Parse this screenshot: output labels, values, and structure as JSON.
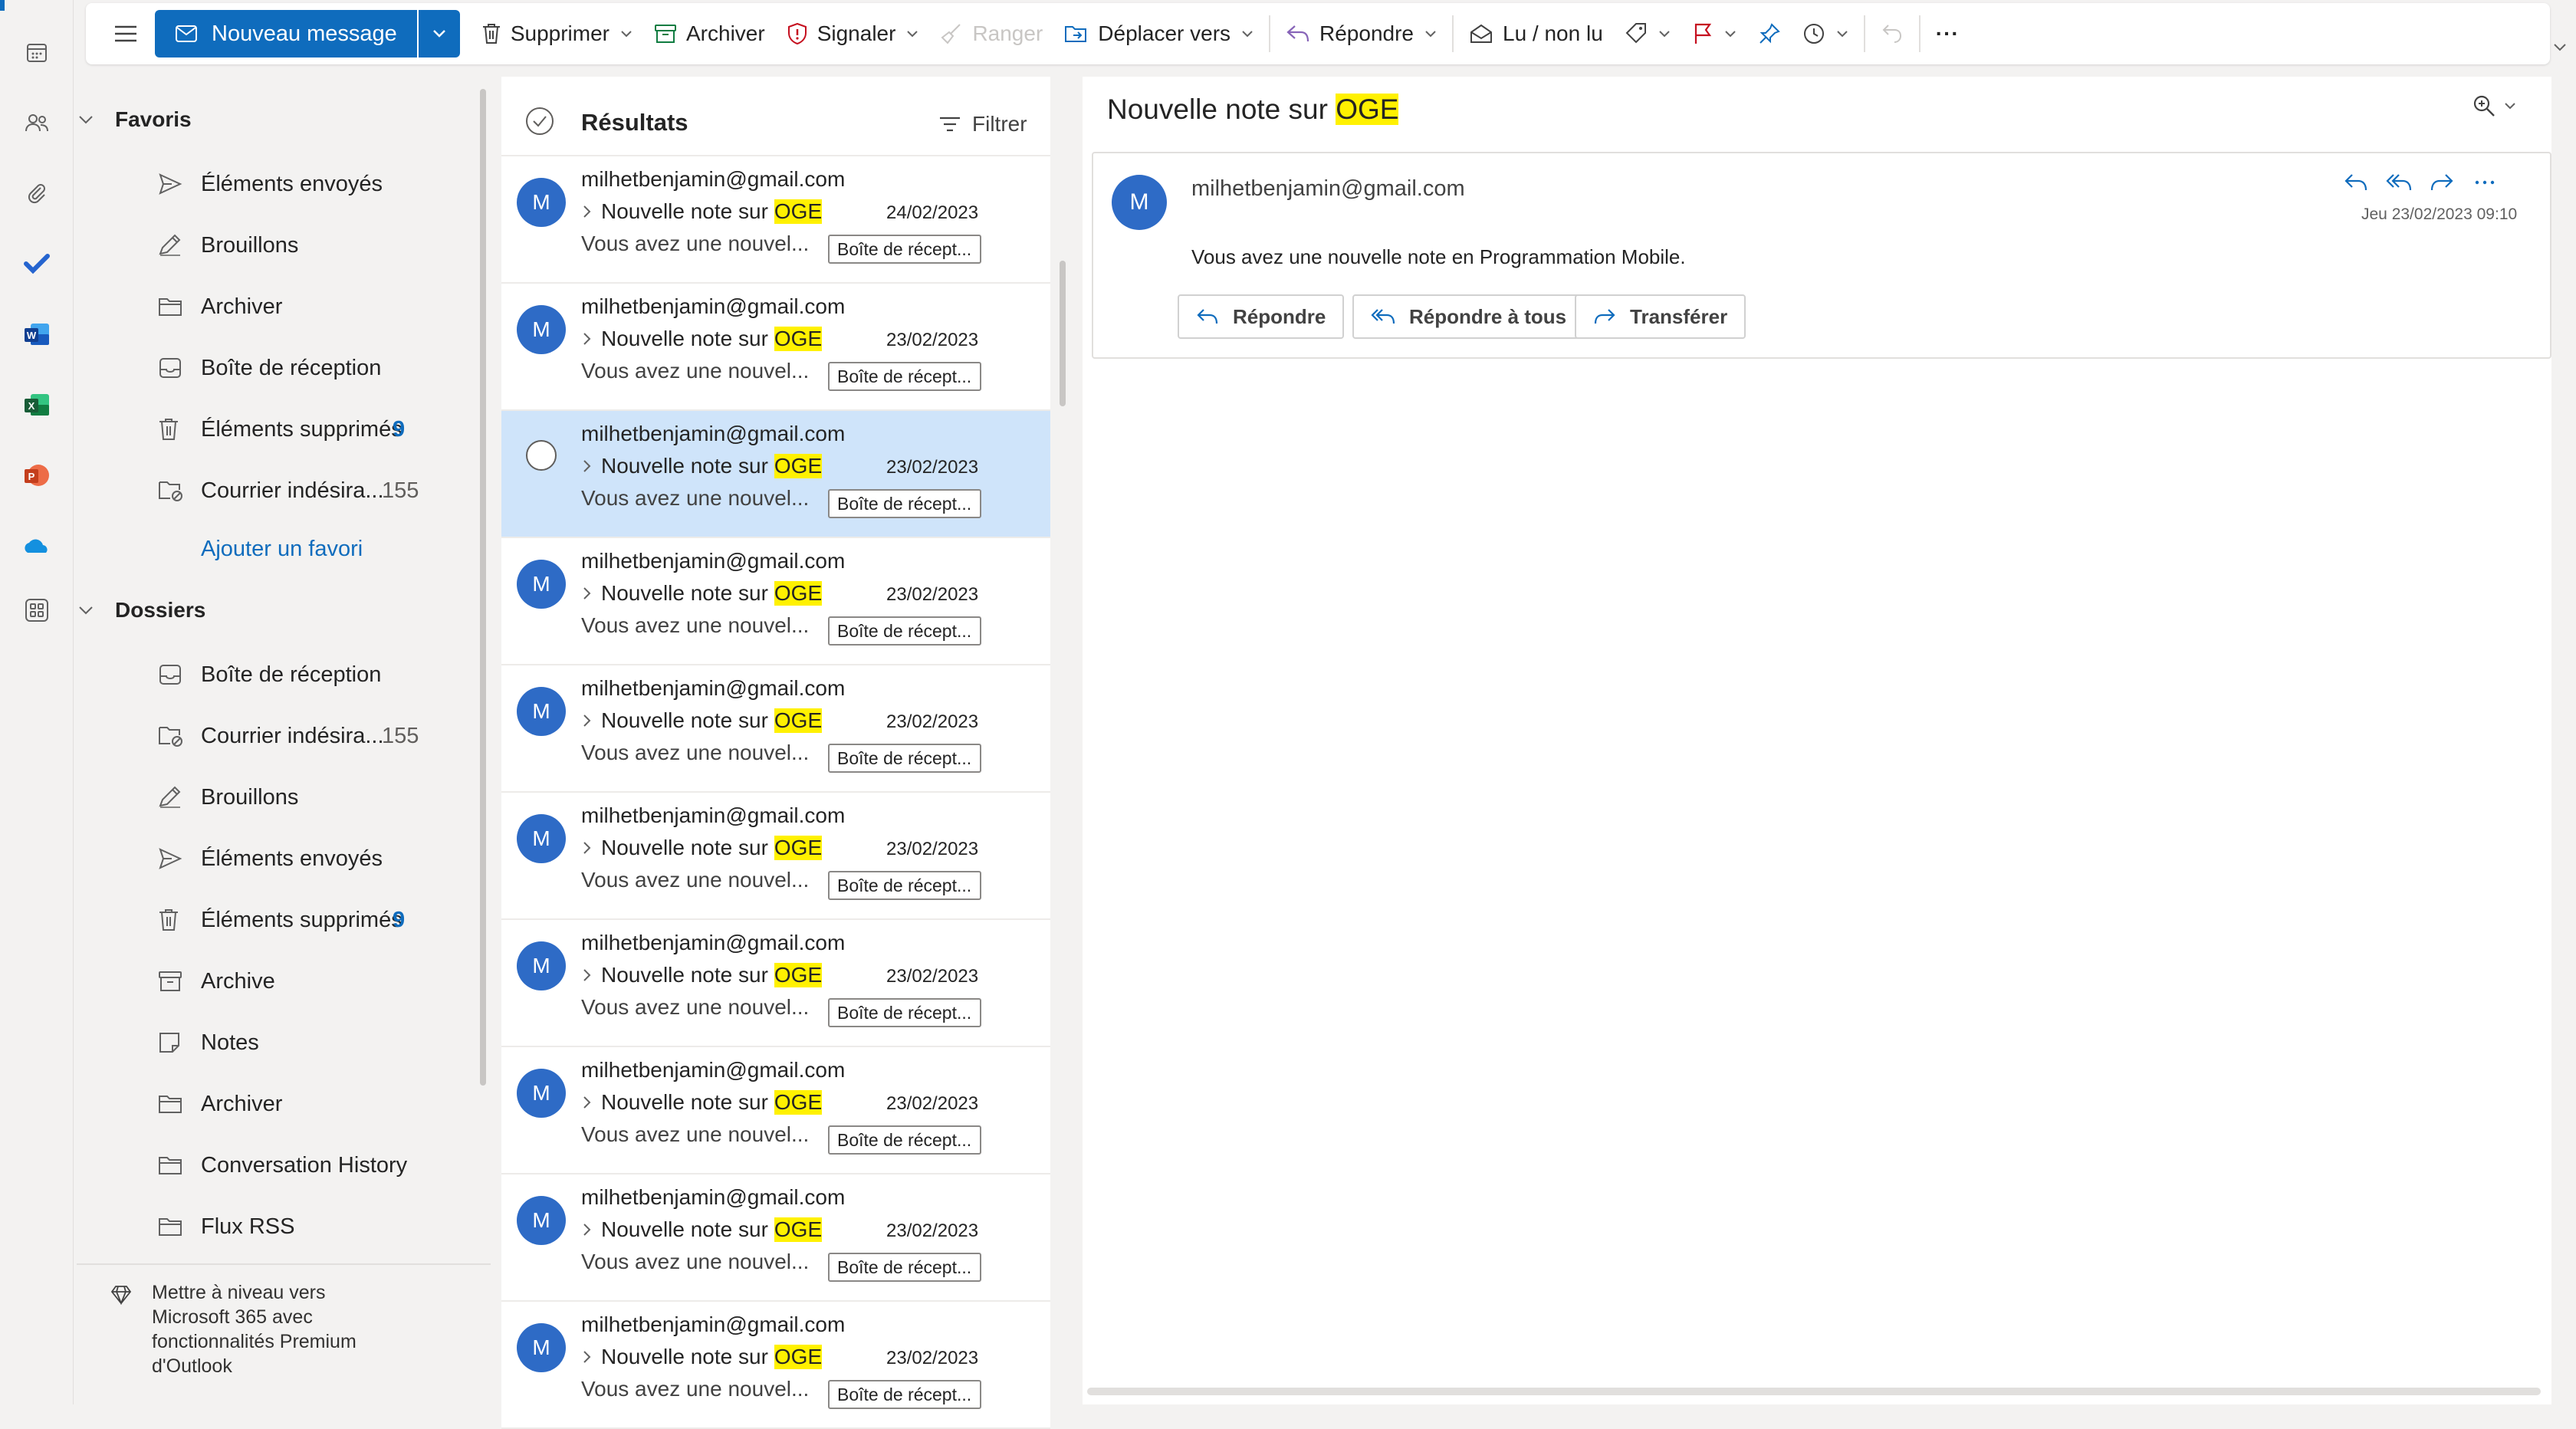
{
  "toolbar": {
    "new_message": "Nouveau message",
    "delete": "Supprimer",
    "archive": "Archiver",
    "report": "Signaler",
    "sweep": "Ranger",
    "move_to": "Déplacer vers",
    "reply": "Répondre",
    "read_unread": "Lu / non lu",
    "more": "···"
  },
  "folders": {
    "favorites_header": "Favoris",
    "favorites": [
      {
        "label": "Éléments envoyés",
        "icon": "send-icon",
        "count": ""
      },
      {
        "label": "Brouillons",
        "icon": "draft-icon",
        "count": ""
      },
      {
        "label": "Archiver",
        "icon": "folder-icon",
        "count": ""
      },
      {
        "label": "Boîte de réception",
        "icon": "inbox-icon",
        "count": ""
      },
      {
        "label": "Éléments supprimés",
        "icon": "trash-icon",
        "count": "9"
      },
      {
        "label": "Courrier indésira...",
        "icon": "junk-icon",
        "count": "155"
      }
    ],
    "add_favorite": "Ajouter un favori",
    "folders_header": "Dossiers",
    "items": [
      {
        "label": "Boîte de réception",
        "icon": "inbox-icon",
        "count": ""
      },
      {
        "label": "Courrier indésira...",
        "icon": "junk-icon",
        "count": "155"
      },
      {
        "label": "Brouillons",
        "icon": "draft-icon",
        "count": ""
      },
      {
        "label": "Éléments envoyés",
        "icon": "send-icon",
        "count": ""
      },
      {
        "label": "Éléments supprimés",
        "icon": "trash-icon",
        "count": "9"
      },
      {
        "label": "Archive",
        "icon": "archive-icon",
        "count": ""
      },
      {
        "label": "Notes",
        "icon": "note-icon",
        "count": ""
      },
      {
        "label": "Archiver",
        "icon": "folder-icon",
        "count": ""
      },
      {
        "label": "Conversation History",
        "icon": "folder-icon",
        "count": ""
      },
      {
        "label": "Flux RSS",
        "icon": "folder-icon",
        "count": ""
      }
    ],
    "upsell": [
      "Mettre à niveau vers",
      "Microsoft 365 avec",
      "fonctionnalités Premium",
      "d'Outlook"
    ]
  },
  "list": {
    "title": "Résultats",
    "filter": "Filtrer",
    "messages": [
      {
        "from": "milhetbenjamin@gmail.com",
        "subject_prefix": "Nouvelle note sur ",
        "subject_highlight": "OGE",
        "date": "24/02/2023",
        "preview": "Vous avez une nouvel...",
        "folder": "Boîte de récept...",
        "avatar": "M",
        "selected": false
      },
      {
        "from": "milhetbenjamin@gmail.com",
        "subject_prefix": "Nouvelle note sur ",
        "subject_highlight": "OGE",
        "date": "23/02/2023",
        "preview": "Vous avez une nouvel...",
        "folder": "Boîte de récept...",
        "avatar": "M",
        "selected": false
      },
      {
        "from": "milhetbenjamin@gmail.com",
        "subject_prefix": "Nouvelle note sur ",
        "subject_highlight": "OGE",
        "date": "23/02/2023",
        "preview": "Vous avez une nouvel...",
        "folder": "Boîte de récept...",
        "avatar": "M",
        "selected": true
      },
      {
        "from": "milhetbenjamin@gmail.com",
        "subject_prefix": "Nouvelle note sur ",
        "subject_highlight": "OGE",
        "date": "23/02/2023",
        "preview": "Vous avez une nouvel...",
        "folder": "Boîte de récept...",
        "avatar": "M",
        "selected": false
      },
      {
        "from": "milhetbenjamin@gmail.com",
        "subject_prefix": "Nouvelle note sur ",
        "subject_highlight": "OGE",
        "date": "23/02/2023",
        "preview": "Vous avez une nouvel...",
        "folder": "Boîte de récept...",
        "avatar": "M",
        "selected": false
      },
      {
        "from": "milhetbenjamin@gmail.com",
        "subject_prefix": "Nouvelle note sur ",
        "subject_highlight": "OGE",
        "date": "23/02/2023",
        "preview": "Vous avez une nouvel...",
        "folder": "Boîte de récept...",
        "avatar": "M",
        "selected": false
      },
      {
        "from": "milhetbenjamin@gmail.com",
        "subject_prefix": "Nouvelle note sur ",
        "subject_highlight": "OGE",
        "date": "23/02/2023",
        "preview": "Vous avez une nouvel...",
        "folder": "Boîte de récept...",
        "avatar": "M",
        "selected": false
      },
      {
        "from": "milhetbenjamin@gmail.com",
        "subject_prefix": "Nouvelle note sur ",
        "subject_highlight": "OGE",
        "date": "23/02/2023",
        "preview": "Vous avez une nouvel...",
        "folder": "Boîte de récept...",
        "avatar": "M",
        "selected": false
      },
      {
        "from": "milhetbenjamin@gmail.com",
        "subject_prefix": "Nouvelle note sur ",
        "subject_highlight": "OGE",
        "date": "23/02/2023",
        "preview": "Vous avez une nouvel...",
        "folder": "Boîte de récept...",
        "avatar": "M",
        "selected": false
      },
      {
        "from": "milhetbenjamin@gmail.com",
        "subject_prefix": "Nouvelle note sur ",
        "subject_highlight": "OGE",
        "date": "23/02/2023",
        "preview": "Vous avez une nouvel...",
        "folder": "Boîte de récept...",
        "avatar": "M",
        "selected": false
      }
    ]
  },
  "reading": {
    "subject_prefix": "Nouvelle note sur ",
    "subject_highlight": "OGE",
    "avatar": "M",
    "sender": "milhetbenjamin@gmail.com",
    "timestamp": "Jeu 23/02/2023 09:10",
    "body": "Vous avez une nouvelle note en Programmation Mobile.",
    "reply": "Répondre",
    "reply_all": "Répondre à tous",
    "forward": "Transférer"
  },
  "colors": {
    "accent": "#0f6cbd",
    "highlight": "#fff100",
    "selected_row": "#cfe4fa",
    "avatar": "#2e6bc6"
  }
}
